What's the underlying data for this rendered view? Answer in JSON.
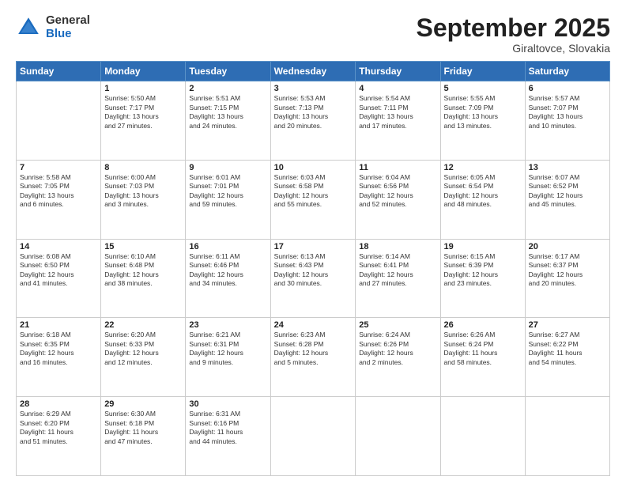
{
  "logo": {
    "general": "General",
    "blue": "Blue"
  },
  "title": "September 2025",
  "subtitle": "Giraltovce, Slovakia",
  "days_of_week": [
    "Sunday",
    "Monday",
    "Tuesday",
    "Wednesday",
    "Thursday",
    "Friday",
    "Saturday"
  ],
  "weeks": [
    [
      {
        "day": "",
        "info": ""
      },
      {
        "day": "1",
        "info": "Sunrise: 5:50 AM\nSunset: 7:17 PM\nDaylight: 13 hours\nand 27 minutes."
      },
      {
        "day": "2",
        "info": "Sunrise: 5:51 AM\nSunset: 7:15 PM\nDaylight: 13 hours\nand 24 minutes."
      },
      {
        "day": "3",
        "info": "Sunrise: 5:53 AM\nSunset: 7:13 PM\nDaylight: 13 hours\nand 20 minutes."
      },
      {
        "day": "4",
        "info": "Sunrise: 5:54 AM\nSunset: 7:11 PM\nDaylight: 13 hours\nand 17 minutes."
      },
      {
        "day": "5",
        "info": "Sunrise: 5:55 AM\nSunset: 7:09 PM\nDaylight: 13 hours\nand 13 minutes."
      },
      {
        "day": "6",
        "info": "Sunrise: 5:57 AM\nSunset: 7:07 PM\nDaylight: 13 hours\nand 10 minutes."
      }
    ],
    [
      {
        "day": "7",
        "info": "Sunrise: 5:58 AM\nSunset: 7:05 PM\nDaylight: 13 hours\nand 6 minutes."
      },
      {
        "day": "8",
        "info": "Sunrise: 6:00 AM\nSunset: 7:03 PM\nDaylight: 13 hours\nand 3 minutes."
      },
      {
        "day": "9",
        "info": "Sunrise: 6:01 AM\nSunset: 7:01 PM\nDaylight: 12 hours\nand 59 minutes."
      },
      {
        "day": "10",
        "info": "Sunrise: 6:03 AM\nSunset: 6:58 PM\nDaylight: 12 hours\nand 55 minutes."
      },
      {
        "day": "11",
        "info": "Sunrise: 6:04 AM\nSunset: 6:56 PM\nDaylight: 12 hours\nand 52 minutes."
      },
      {
        "day": "12",
        "info": "Sunrise: 6:05 AM\nSunset: 6:54 PM\nDaylight: 12 hours\nand 48 minutes."
      },
      {
        "day": "13",
        "info": "Sunrise: 6:07 AM\nSunset: 6:52 PM\nDaylight: 12 hours\nand 45 minutes."
      }
    ],
    [
      {
        "day": "14",
        "info": "Sunrise: 6:08 AM\nSunset: 6:50 PM\nDaylight: 12 hours\nand 41 minutes."
      },
      {
        "day": "15",
        "info": "Sunrise: 6:10 AM\nSunset: 6:48 PM\nDaylight: 12 hours\nand 38 minutes."
      },
      {
        "day": "16",
        "info": "Sunrise: 6:11 AM\nSunset: 6:46 PM\nDaylight: 12 hours\nand 34 minutes."
      },
      {
        "day": "17",
        "info": "Sunrise: 6:13 AM\nSunset: 6:43 PM\nDaylight: 12 hours\nand 30 minutes."
      },
      {
        "day": "18",
        "info": "Sunrise: 6:14 AM\nSunset: 6:41 PM\nDaylight: 12 hours\nand 27 minutes."
      },
      {
        "day": "19",
        "info": "Sunrise: 6:15 AM\nSunset: 6:39 PM\nDaylight: 12 hours\nand 23 minutes."
      },
      {
        "day": "20",
        "info": "Sunrise: 6:17 AM\nSunset: 6:37 PM\nDaylight: 12 hours\nand 20 minutes."
      }
    ],
    [
      {
        "day": "21",
        "info": "Sunrise: 6:18 AM\nSunset: 6:35 PM\nDaylight: 12 hours\nand 16 minutes."
      },
      {
        "day": "22",
        "info": "Sunrise: 6:20 AM\nSunset: 6:33 PM\nDaylight: 12 hours\nand 12 minutes."
      },
      {
        "day": "23",
        "info": "Sunrise: 6:21 AM\nSunset: 6:31 PM\nDaylight: 12 hours\nand 9 minutes."
      },
      {
        "day": "24",
        "info": "Sunrise: 6:23 AM\nSunset: 6:28 PM\nDaylight: 12 hours\nand 5 minutes."
      },
      {
        "day": "25",
        "info": "Sunrise: 6:24 AM\nSunset: 6:26 PM\nDaylight: 12 hours\nand 2 minutes."
      },
      {
        "day": "26",
        "info": "Sunrise: 6:26 AM\nSunset: 6:24 PM\nDaylight: 11 hours\nand 58 minutes."
      },
      {
        "day": "27",
        "info": "Sunrise: 6:27 AM\nSunset: 6:22 PM\nDaylight: 11 hours\nand 54 minutes."
      }
    ],
    [
      {
        "day": "28",
        "info": "Sunrise: 6:29 AM\nSunset: 6:20 PM\nDaylight: 11 hours\nand 51 minutes."
      },
      {
        "day": "29",
        "info": "Sunrise: 6:30 AM\nSunset: 6:18 PM\nDaylight: 11 hours\nand 47 minutes."
      },
      {
        "day": "30",
        "info": "Sunrise: 6:31 AM\nSunset: 6:16 PM\nDaylight: 11 hours\nand 44 minutes."
      },
      {
        "day": "",
        "info": ""
      },
      {
        "day": "",
        "info": ""
      },
      {
        "day": "",
        "info": ""
      },
      {
        "day": "",
        "info": ""
      }
    ]
  ]
}
